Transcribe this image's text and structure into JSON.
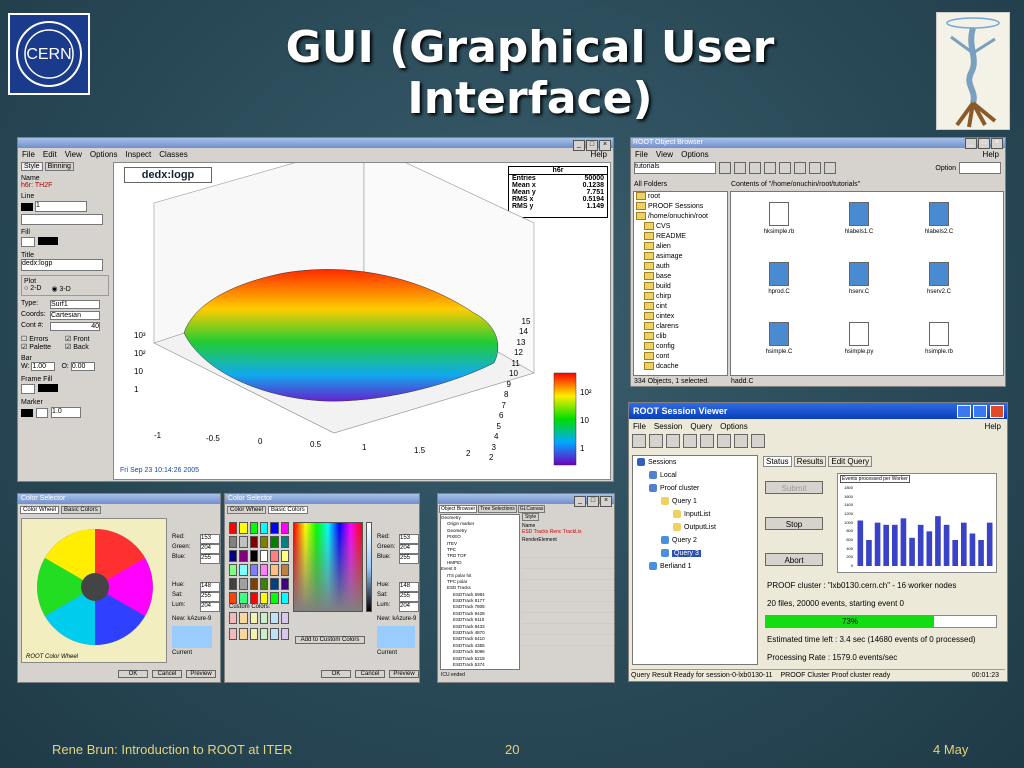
{
  "slide": {
    "title": "GUI (Graphical User Interface)",
    "footer_left": "Rene Brun: Introduction to ROOT at ITER",
    "footer_center": "20",
    "footer_right": "4 May",
    "logo_text": "CERN"
  },
  "ged": {
    "menu": [
      "File",
      "Edit",
      "View",
      "Options",
      "Inspect",
      "Classes"
    ],
    "help": "Help",
    "tabs": [
      "Style",
      "Binning"
    ],
    "name_label": "Name",
    "name_value": "h6r: TH2F",
    "line_label": "Line",
    "line_width": "1",
    "fill_label": "Fill",
    "title_label": "Title",
    "title_value": "dedx:logp",
    "plot_label": "Plot",
    "plot_2d": "2-D",
    "plot_3d": "3-D",
    "type_label": "Type:",
    "type_value": "Surf1",
    "coords_label": "Coords:",
    "coords_value": "Cartesian",
    "cont_label": "Cont #:",
    "cont_value": "40",
    "errors": "Errors",
    "front": "Front",
    "palette": "Palette",
    "back": "Back",
    "bar_label": "Bar",
    "bar_w_label": "W:",
    "bar_w": "1.00",
    "bar_o_label": "O:",
    "bar_o": "0.00",
    "frame_fill": "Frame Fill",
    "marker_label": "Marker",
    "marker_size": "1.0",
    "plot_title": "dedx:logp",
    "stats_title": "h6r",
    "stats": [
      [
        "Entries",
        "50000"
      ],
      [
        "Mean x",
        "0.1238"
      ],
      [
        "Mean y",
        "7.751"
      ],
      [
        "RMS x",
        "0.5194"
      ],
      [
        "RMS y",
        "1.149"
      ]
    ],
    "date": "Fri Sep 23 10:14:26 2005",
    "x_ticks": [
      "-1",
      "-0.5",
      "0",
      "0.5",
      "1",
      "1.5",
      "2"
    ],
    "y_ticks": [
      "2",
      "3",
      "4",
      "5",
      "6",
      "7",
      "8",
      "9",
      "10",
      "11",
      "12",
      "13",
      "14",
      "15"
    ],
    "z_ticks": [
      "10³",
      "10²",
      "10",
      "1"
    ],
    "palette_ticks": [
      "10²",
      "10",
      "1"
    ]
  },
  "browser": {
    "title": "ROOT Object Browser",
    "menu": [
      "File",
      "View",
      "Options"
    ],
    "help": "Help",
    "combo": "tutorials",
    "option_label": "Option",
    "all_folders": "All Folders",
    "contents": "Contents of \"/home/onuchin/root/tutorials\"",
    "tree": [
      "root",
      "PROOF Sessions",
      "/home/onuchin/root",
      "CVS",
      "README",
      "alien",
      "asimage",
      "auth",
      "base",
      "build",
      "chirp",
      "cint",
      "cintex",
      "clarens",
      "clib",
      "config",
      "cont",
      "dcache"
    ],
    "files": [
      "hksimple.rb",
      "hlabels1.C",
      "hlabels2.C",
      "hprod.C",
      "hserv.C",
      "hserv2.C",
      "hsimple.C",
      "hsimple.py",
      "hsimple.rb"
    ],
    "status_left": "334 Objects, 1 selected.",
    "status_right": "hadd.C"
  },
  "session": {
    "title": "ROOT Session Viewer",
    "menu": [
      "File",
      "Session",
      "Query",
      "Options"
    ],
    "help": "Help",
    "tree": [
      "Sessions",
      "Local",
      "Proof cluster",
      "Query 1",
      "InputList",
      "OutputList",
      "Query 2",
      "Query 3",
      "Berliand 1"
    ],
    "tabs": [
      "Status",
      "Results",
      "Edit Query"
    ],
    "submit": "Submit",
    "stop": "Stop",
    "abort": "Abort",
    "chart_title": "Events processed per Worker",
    "chart_data": {
      "type": "bar",
      "values": [
        1050,
        600,
        1000,
        950,
        950,
        1100,
        650,
        950,
        800,
        1150,
        950,
        600,
        1000,
        750,
        600,
        1000
      ],
      "ylim": [
        0,
        1800
      ],
      "yticks": [
        "1800",
        "1600",
        "1400",
        "1200",
        "1000",
        "800",
        "600",
        "400",
        "200",
        "0"
      ]
    },
    "info1": "PROOF cluster : \"lxb0130.cern.ch\" - 16 worker nodes",
    "info2": "20 files, 20000 events, starting event 0",
    "progress": 0.73,
    "progress_label": "73%",
    "time_left": "Estimated time left : 3.4 sec (14680 events of 0 processed)",
    "rate": "Processing Rate : 1579.0 events/sec",
    "status1": "Query Result Ready for session-0-lxb0130-11",
    "status2": "PROOF Cluster Proof cluster ready",
    "clock": "00:01:23"
  },
  "colorsel1": {
    "title": "Color Selector",
    "tabs": [
      "Color Wheel",
      "Basic Colors"
    ],
    "fields": [
      [
        "Red:",
        "153"
      ],
      [
        "Green:",
        "204"
      ],
      [
        "Blue:",
        "255"
      ],
      [
        "Hue:",
        "148"
      ],
      [
        "Sat:",
        "255"
      ],
      [
        "Lum:",
        "204"
      ]
    ],
    "new_label": "New: kAzure-9",
    "current": "Current",
    "wheel_label": "ROOT Color Wheel",
    "buttons": [
      "OK",
      "Cancel",
      "Preview"
    ]
  },
  "colorsel2": {
    "title": "Color Selector",
    "tabs": [
      "Color Wheel",
      "Basic Colors"
    ],
    "fields": [
      [
        "Red:",
        "153"
      ],
      [
        "Green:",
        "204"
      ],
      [
        "Blue:",
        "255"
      ],
      [
        "Hue:",
        "148"
      ],
      [
        "Sat:",
        "255"
      ],
      [
        "Lum:",
        "204"
      ]
    ],
    "custom": "Custom Colors:",
    "add_custom": "Add to Custom Colors",
    "new_label": "New: kAzure-9",
    "current": "Current",
    "buttons": [
      "OK",
      "Cancel",
      "Preview"
    ]
  },
  "eve": {
    "tabs": [
      "Object Browser",
      "Tree Selections",
      "GLCanvas"
    ],
    "tree": [
      "Geometry",
      "Origin marker",
      "Geometry",
      "PIXEO",
      "ITEV",
      "TPC",
      "TRD TOF",
      "HMPID",
      "Event 0",
      "ITS polar hit",
      "TPC polar",
      "ESD Tracks",
      "ESDTrack 6984",
      "ESDTrack 8177",
      "ESDTrack 7808",
      "ESDTrack 9428",
      "ESDTrack 9110",
      "ESDTrack 8433",
      "ESDTrack 4870",
      "ESDTrack 6410",
      "ESDTrack 4355",
      "ESDTrack 5096",
      "ESDTrack 5218",
      "ESDTrack 5374"
    ],
    "style_tab": "Style",
    "name_label": "Name",
    "name_value": "ESD Tracks Renc TrackLis",
    "render_label": "RenderElement",
    "status": "ICU ended"
  }
}
